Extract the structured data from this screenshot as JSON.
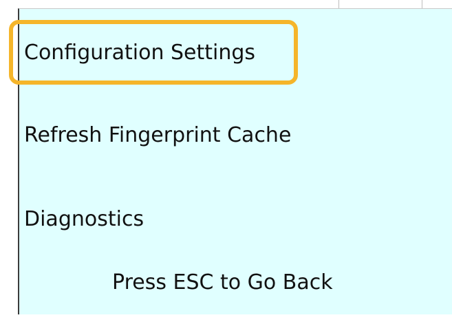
{
  "menu": {
    "items": [
      {
        "label": "Configuration Settings",
        "selected": true
      },
      {
        "label": "Refresh Fingerprint Cache",
        "selected": false
      },
      {
        "label": "Diagnostics",
        "selected": false
      }
    ]
  },
  "footer": {
    "hint": "Press ESC to Go Back"
  },
  "colors": {
    "panel_background": "#e0ffff",
    "focus_ring": "#f5b52a",
    "text": "#111111"
  }
}
